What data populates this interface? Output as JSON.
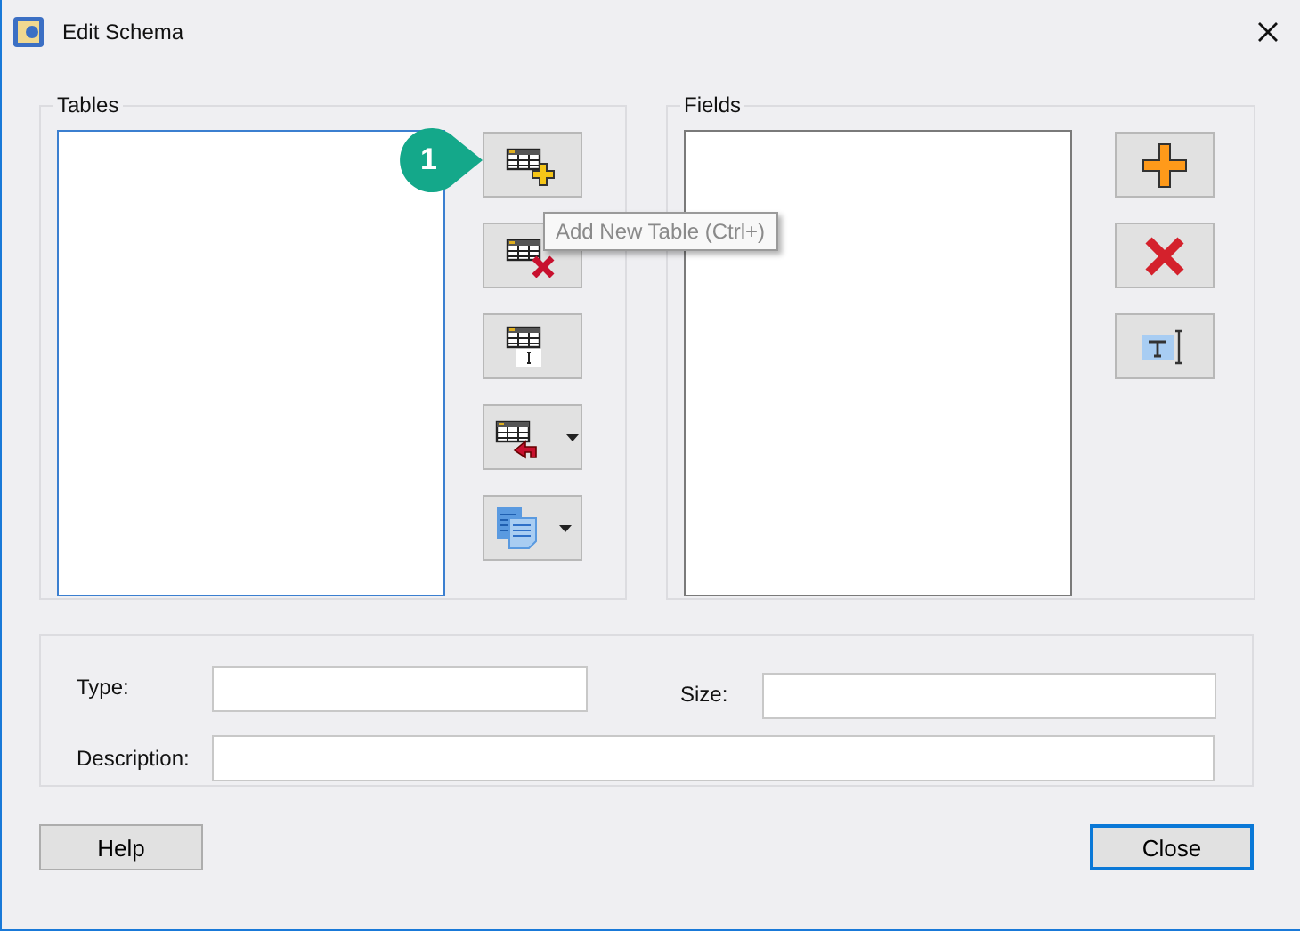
{
  "window": {
    "title": "Edit Schema"
  },
  "tables_group": {
    "label": "Tables",
    "buttons": [
      {
        "kind": "add-table",
        "dropdown": false
      },
      {
        "kind": "delete-table",
        "dropdown": false
      },
      {
        "kind": "rename-table",
        "dropdown": false
      },
      {
        "kind": "import-table",
        "dropdown": true
      },
      {
        "kind": "copy",
        "dropdown": true
      }
    ]
  },
  "tooltip": {
    "text": "Add New Table (Ctrl+)"
  },
  "callout": {
    "number": "1"
  },
  "fields_group": {
    "label": "Fields",
    "buttons": [
      {
        "kind": "add",
        "dropdown": false
      },
      {
        "kind": "delete",
        "dropdown": false
      },
      {
        "kind": "rename",
        "dropdown": false
      }
    ]
  },
  "form": {
    "type_label": "Type:",
    "size_label": "Size:",
    "description_label": "Description:"
  },
  "buttons": [
    {
      "label": "Help",
      "default": false
    },
    {
      "label": "Close",
      "default": true
    }
  ]
}
